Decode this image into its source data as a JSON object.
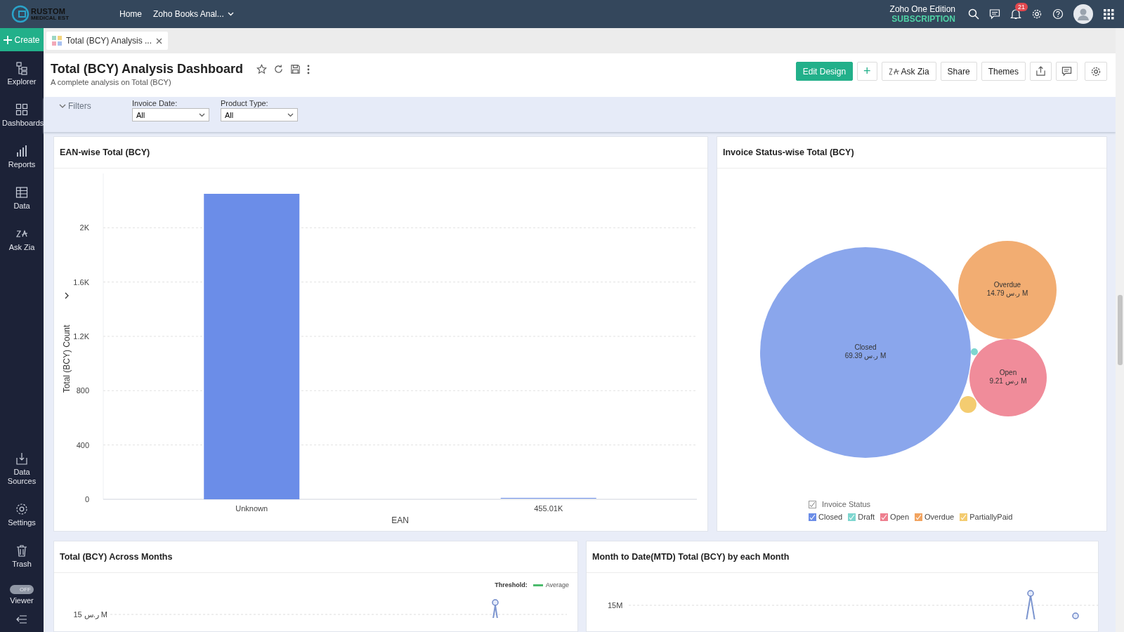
{
  "topbar": {
    "logo": {
      "name": "RUSTOM",
      "tagline": "MEDICAL EST"
    },
    "nav": [
      {
        "label": "Home",
        "dropdown": false
      },
      {
        "label": "Zoho Books Anal...",
        "dropdown": true
      }
    ],
    "edition": "Zoho One Edition",
    "plan": "SUBSCRIPTION",
    "notification_count": "21"
  },
  "create_button": "Create",
  "sidebar": {
    "items": [
      {
        "label": "Explorer"
      },
      {
        "label": "Dashboards"
      },
      {
        "label": "Reports"
      },
      {
        "label": "Data"
      },
      {
        "label": "Ask Zia"
      }
    ],
    "bottom_items": [
      {
        "label": "Data Sources"
      },
      {
        "label": "Settings"
      },
      {
        "label": "Trash"
      }
    ],
    "viewer": {
      "label": "Viewer",
      "toggle_text": "OFF",
      "on": false
    }
  },
  "tabs": [
    {
      "label": "Total (BCY) Analysis ...",
      "selected": true
    }
  ],
  "dashboard": {
    "title": "Total (BCY) Analysis Dashboard",
    "subtitle": "A complete analysis on Total (BCY)",
    "buttons": [
      {
        "label": "Edit Design",
        "kind": "primary"
      },
      {
        "label": "+",
        "kind": "plus"
      },
      {
        "label": "Ask Zia",
        "kind": "zia"
      },
      {
        "label": "Share",
        "kind": "text"
      },
      {
        "label": "Themes",
        "kind": "text"
      }
    ]
  },
  "filters": {
    "toggle": "Filters",
    "expanded": true,
    "fields": [
      {
        "label": "Invoice Date:",
        "value": "All"
      },
      {
        "label": "Product Type:",
        "value": "All"
      }
    ]
  },
  "ean_chart": {
    "title": "EAN-wise Total (BCY)",
    "chart_data": {
      "type": "bar",
      "xlabel": "EAN",
      "ylabel": "Total (BCY) Count",
      "categories": [
        "Unknown",
        "455.01K"
      ],
      "series": [
        {
          "color": "#6b8de8",
          "values": [
            2250,
            5
          ]
        }
      ],
      "grid": true,
      "ylim": [
        0,
        2400
      ],
      "yticks": [
        {
          "value": 0,
          "label": "0"
        },
        {
          "value": 400,
          "label": "400"
        },
        {
          "value": 800,
          "label": "800"
        },
        {
          "value": 1200,
          "label": "1.2K"
        },
        {
          "value": 1600,
          "label": "1.6K"
        },
        {
          "value": 2000,
          "label": "2K"
        }
      ]
    }
  },
  "status_chart": {
    "title": "Invoice Status-wise Total (BCY)",
    "bubbles": [
      {
        "name": "Closed",
        "value": "69.39 ر.س M",
        "color": "#8aa6ec"
      },
      {
        "name": "Overdue",
        "value": "14.79 ر.س M",
        "color": "#f2ad72"
      },
      {
        "color": "#7ed6cf"
      },
      {
        "name": "Open",
        "value": "9.21 ر.س M",
        "color": "#f08c9a"
      },
      {
        "color": "#f4cc70"
      }
    ],
    "legend_title": "Invoice Status",
    "legend_all_checked": true,
    "legend": [
      {
        "label": "Closed",
        "color": "#6b8de8",
        "checked": true
      },
      {
        "label": "Draft",
        "color": "#7ed6cf",
        "checked": true
      },
      {
        "label": "Open",
        "color": "#ee7f8f",
        "checked": true
      },
      {
        "label": "Overdue",
        "color": "#f2a35f",
        "checked": true
      },
      {
        "label": "PartiallyPaid",
        "color": "#f4cc70",
        "checked": true
      }
    ]
  },
  "months_chart": {
    "title": "Total (BCY) Across Months",
    "threshold": {
      "label": "Threshold:",
      "name": "Average",
      "color": "#4cbb6c"
    },
    "tick": "15 ر.س M"
  },
  "mtd_chart": {
    "title": "Month to Date(MTD) Total (BCY) by each Month",
    "tick": "15M"
  }
}
